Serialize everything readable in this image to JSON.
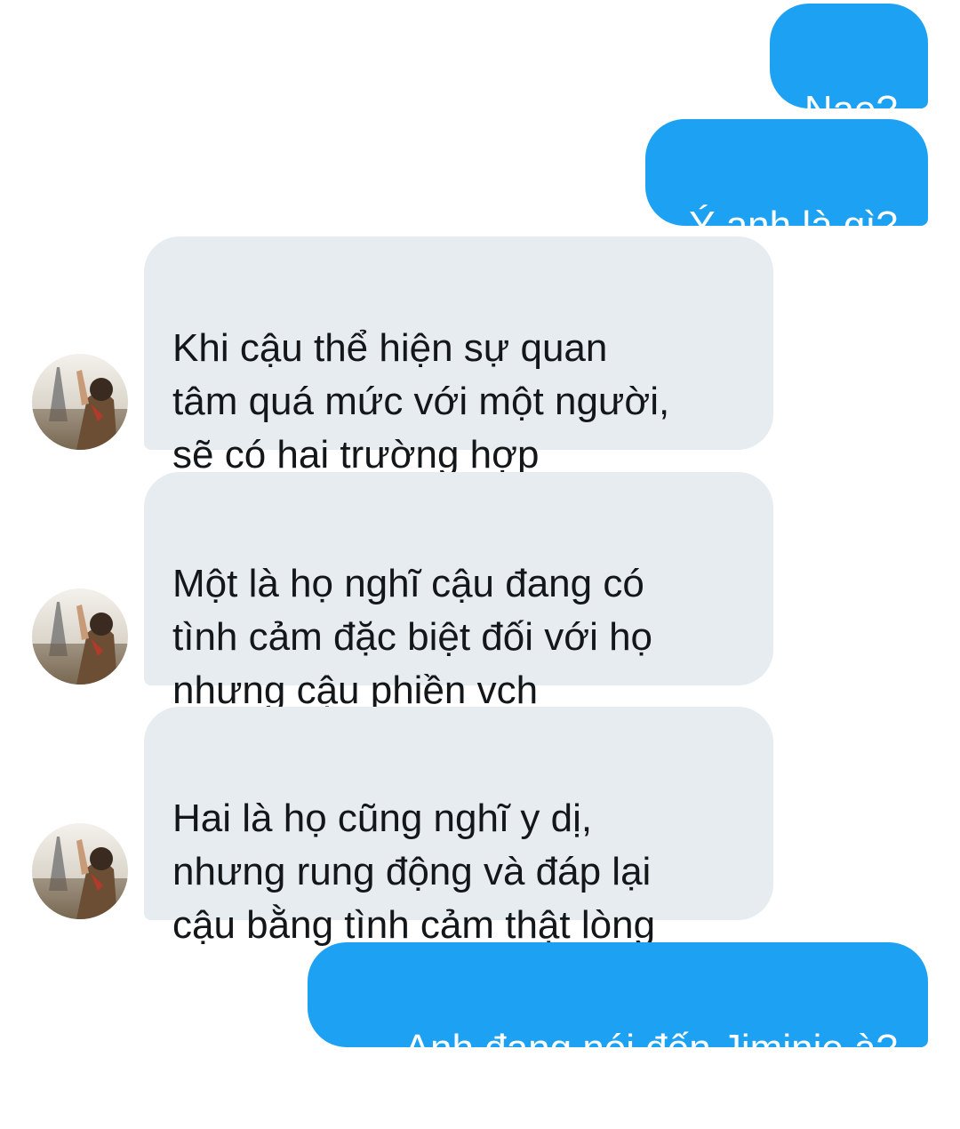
{
  "messages": [
    {
      "direction": "outgoing",
      "text": "Nae?"
    },
    {
      "direction": "outgoing",
      "text": "Ý anh là gì?"
    },
    {
      "direction": "incoming",
      "text": "Khi cậu thể hiện sự quan\ntâm quá mức với một người,\nsẽ có hai trường hợp"
    },
    {
      "direction": "incoming",
      "text": "Một là họ nghĩ cậu đang có\ntình cảm đặc biệt đối với họ\nnhưng cậu phiền vch"
    },
    {
      "direction": "incoming",
      "text": "Hai là họ cũng nghĩ y dị,\nnhưng rung động và đáp lại\ncậu bằng tình cảm thật lòng"
    },
    {
      "direction": "outgoing",
      "text": "Anh đang nói đến Jiminie à?"
    }
  ],
  "colors": {
    "outgoing_bubble": "#1da1f2",
    "outgoing_text": "#ffffff",
    "incoming_bubble": "#e6ecf0",
    "incoming_text": "#14171a"
  },
  "avatar": {
    "icon": "user-avatar-photo"
  }
}
